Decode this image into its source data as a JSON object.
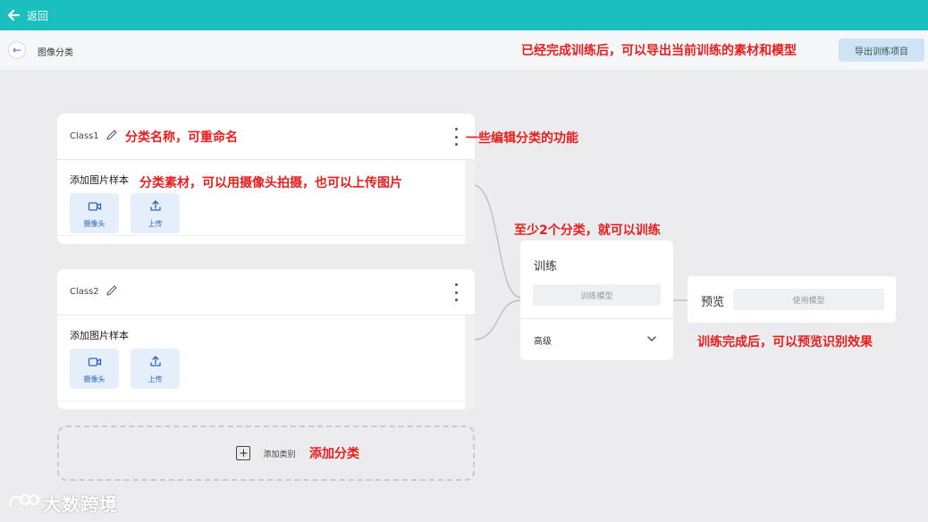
{
  "topbar": {
    "back_label": "返回"
  },
  "header": {
    "title": "图像分类",
    "export_button": "导出训练项目"
  },
  "classes": [
    {
      "name": "Class1",
      "sample_label": "添加图片样本",
      "webcam_label": "摄像头",
      "upload_label": "上传"
    },
    {
      "name": "Class2",
      "sample_label": "添加图片样本",
      "webcam_label": "摄像头",
      "upload_label": "上传"
    }
  ],
  "add_class_label": "添加类别",
  "training": {
    "title": "训练",
    "train_button": "训练模型",
    "advanced_label": "高级"
  },
  "preview": {
    "title": "预览",
    "use_model_button": "使用模型"
  },
  "annotations": {
    "export": "已经完成训练后，可以导出当前训练的素材和模型",
    "rename": "分类名称，可重命名",
    "edit_menu": "一些编辑分类的功能",
    "samples": "分类素材，可以用摄像头拍摄，也可以上传图片",
    "min_classes": "至少2个分类，就可以训练",
    "add_class": "添加分类",
    "preview": "训练完成后，可以预览识别效果"
  },
  "watermark": {
    "text": "大数跨境"
  },
  "colors": {
    "topbar": "#1bbfbf",
    "annotation": "#e81e1e",
    "button_bg": "#e4effb",
    "export_bg": "#cfe3f7"
  }
}
